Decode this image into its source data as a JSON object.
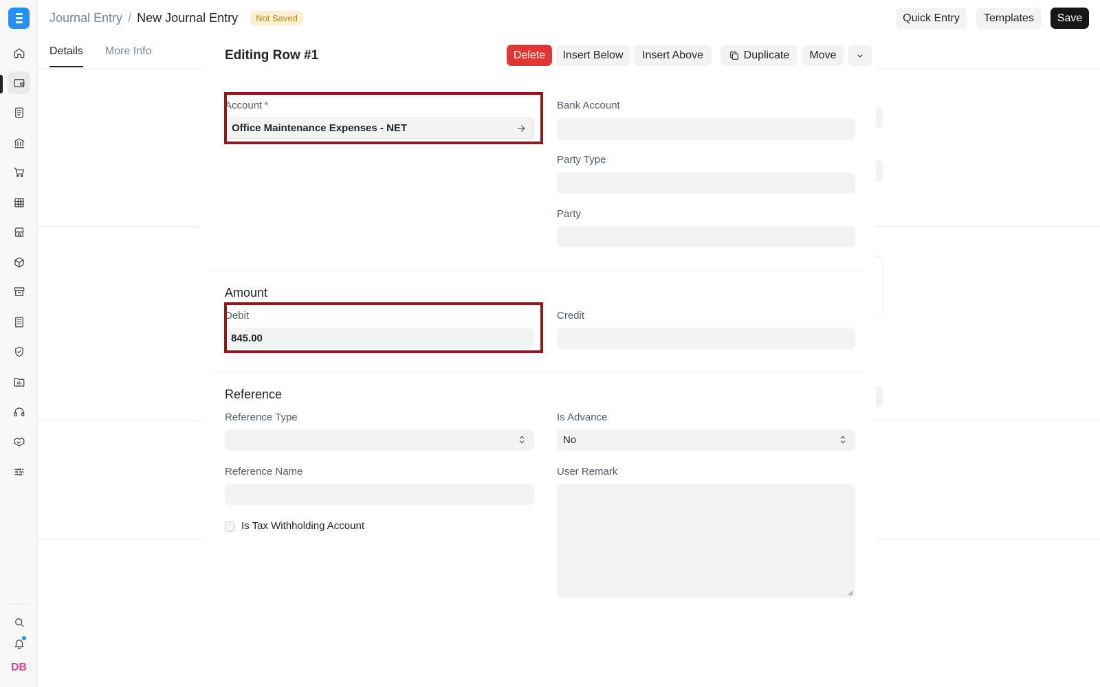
{
  "breadcrumb": {
    "parent": "Journal Entry",
    "separator": "/",
    "current": "New Journal Entry",
    "status_badge": "Not Saved"
  },
  "header_actions": {
    "quick_entry": "Quick Entry",
    "templates": "Templates",
    "save": "Save"
  },
  "tabs": [
    "Details",
    "More Info"
  ],
  "sidebar": {
    "items": [
      "home-icon",
      "wallet-icon",
      "document-icon",
      "bank-icon",
      "cart-icon",
      "table-icon",
      "store-icon",
      "box-icon",
      "archive-icon",
      "building-icon",
      "shield-icon",
      "folder-chart-icon",
      "headset-icon",
      "handshake-icon",
      "sliders-icon"
    ],
    "active_index": 1,
    "avatar_initials": "DB"
  },
  "modal": {
    "title": "Editing Row #1",
    "actions": {
      "delete": "Delete",
      "insert_below": "Insert Below",
      "insert_above": "Insert Above",
      "duplicate": "Duplicate",
      "move": "Move"
    },
    "fields": {
      "account": {
        "label": "Account",
        "required_mark": "*",
        "value": "Office Maintenance Expenses - NET"
      },
      "bank_account": {
        "label": "Bank Account",
        "value": ""
      },
      "party_type": {
        "label": "Party Type",
        "value": ""
      },
      "party": {
        "label": "Party",
        "value": ""
      }
    },
    "amount_section": {
      "title": "Amount",
      "debit": {
        "label": "Debit",
        "value": "845.00"
      },
      "credit": {
        "label": "Credit",
        "value": ""
      }
    },
    "reference_section": {
      "title": "Reference",
      "reference_type": {
        "label": "Reference Type",
        "value": ""
      },
      "is_advance": {
        "label": "Is Advance",
        "value": "No"
      },
      "reference_name": {
        "label": "Reference Name",
        "value": ""
      },
      "user_remark": {
        "label": "User Remark",
        "value": ""
      },
      "is_tax_withholding": {
        "label": "Is Tax Withholding Account",
        "checked": false
      }
    }
  },
  "colors": {
    "accent": "#2490ef",
    "danger": "#e03636",
    "highlight_border": "#8b1a1f",
    "badge_bg": "#fdf0d2",
    "badge_text": "#b7861a"
  }
}
